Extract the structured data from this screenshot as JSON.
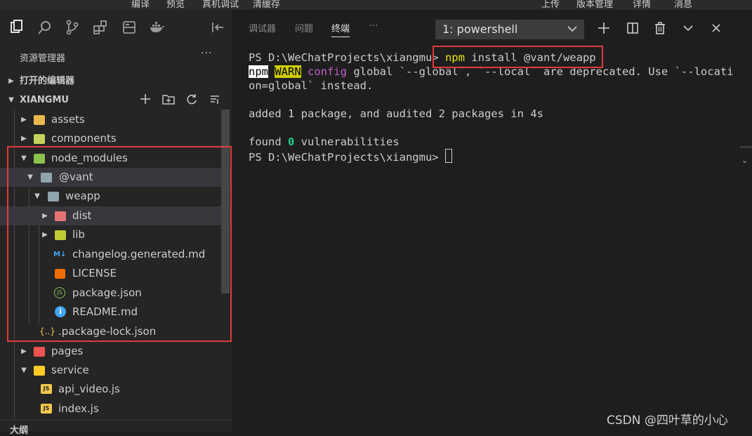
{
  "top_menu": {
    "items": [
      "编译",
      "预览",
      "真机调试",
      "清缓存"
    ],
    "right_items": [
      "上传",
      "版本管理",
      "详情",
      "消息"
    ]
  },
  "activity_icons": [
    "files-icon",
    "search-icon",
    "source-control-icon",
    "extensions-icon",
    "storage-icon",
    "docker-icon"
  ],
  "explorer": {
    "title": "资源管理器",
    "more": "···",
    "open_editors_label": "打开的编辑器",
    "project_label": "XIANGMU",
    "tree": [
      {
        "label": "assets",
        "icon_color": "#e8b94a",
        "arrow": "▶"
      },
      {
        "label": "components",
        "icon_color": "#c6d15a",
        "arrow": "▶"
      },
      {
        "label": "node_modules",
        "icon_color": "#8bc34a",
        "arrow": "▼"
      },
      {
        "label": "@vant",
        "icon_color": "#90a4ae",
        "arrow": "▼"
      },
      {
        "label": "weapp",
        "icon_color": "#90a4ae",
        "arrow": "▼"
      },
      {
        "label": "dist",
        "icon_color": "#e57373",
        "arrow": "▶"
      },
      {
        "label": "lib",
        "icon_color": "#c0ca33",
        "arrow": "▶"
      },
      {
        "label": "changelog.generated.md",
        "icon_text": "M↓",
        "icon_color": "#42a5f5"
      },
      {
        "label": "LICENSE",
        "icon_color": "#ef6c00"
      },
      {
        "label": "package.json",
        "icon_text": "JS",
        "icon_color": "#8bc34a"
      },
      {
        "label": "README.md",
        "icon_text": "i",
        "icon_color": "#42a5f5"
      },
      {
        "label": ".package-lock.json",
        "icon_text": "{..}",
        "icon_color": "#f2c94c"
      },
      {
        "label": "pages",
        "icon_color": "#ef5350",
        "arrow": "▶"
      },
      {
        "label": "service",
        "icon_color": "#ffca28",
        "arrow": "▼"
      },
      {
        "label": "api_video.js",
        "icon_text": "JS",
        "icon_color": "#f2c94c"
      },
      {
        "label": "index.js",
        "icon_text": "JS",
        "icon_color": "#f2c94c"
      }
    ],
    "outline_label": "大纲"
  },
  "terminal_panel": {
    "tabs": [
      "调试器",
      "问题",
      "终端",
      "···"
    ],
    "active_tab": "终端",
    "shell_select": "1: powershell",
    "toolbar_icons": [
      "plus-icon",
      "split-icon",
      "trash-icon",
      "chevron-down-icon",
      "close-icon"
    ],
    "lines": {
      "prompt1": "PS D:\\WeChatProjects\\xiangmu>",
      "cmd_npm": "npm",
      "cmd_rest": " install @vant/weapp",
      "warn_npm": "npm",
      "warn_tag": "WARN",
      "warn_config": "config",
      "warn_msg1": " global `--global`, `--local` are deprecated. Use `--locati",
      "warn_msg2": "on=global` instead.",
      "added": "added 1 package, and audited 2 packages in 4s",
      "found_pre": "found ",
      "found_zero": "0",
      "found_post": " vulnerabilities",
      "prompt2": "PS D:\\WeChatProjects\\xiangmu>"
    }
  },
  "watermark": "CSDN @四叶草的小心",
  "colors": {
    "highlight_box": "#e03b3b"
  }
}
